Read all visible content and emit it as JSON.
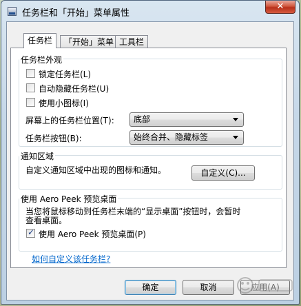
{
  "window": {
    "title": "任务栏和「开始」菜单属性",
    "close_label": "✕"
  },
  "tabs": [
    {
      "label": "任务栏"
    },
    {
      "label": "「开始」菜单"
    },
    {
      "label": "工具栏"
    }
  ],
  "appearance": {
    "legend": "任务栏外观",
    "lock": {
      "label": "锁定任务栏(L)",
      "checked": false
    },
    "autohide": {
      "label": "自动隐藏任务栏(U)",
      "checked": false
    },
    "small_icons": {
      "label": "使用小图标(I)",
      "checked": false
    },
    "position": {
      "label": "屏幕上的任务栏位置(T):",
      "value": "底部"
    },
    "buttons": {
      "label": "任务栏按钮(B):",
      "value": "始终合并、隐藏标签"
    }
  },
  "notification": {
    "legend": "通知区域",
    "text": "自定义通知区域中出现的图标和通知。",
    "customize_label": "自定义(C)..."
  },
  "peek": {
    "legend": "使用 Aero Peek 预览桌面",
    "description_line1": "当您将鼠标移动到任务栏末端的“显示桌面”按钮时，会暂时",
    "description_line2": "查看桌面。",
    "checkbox": {
      "label": "使用 Aero Peek 预览桌面(P)",
      "checked": true
    }
  },
  "help_link": "如何自定义该任务栏?",
  "footer": {
    "ok": "确定",
    "cancel": "取消",
    "apply": "应用(A)"
  }
}
